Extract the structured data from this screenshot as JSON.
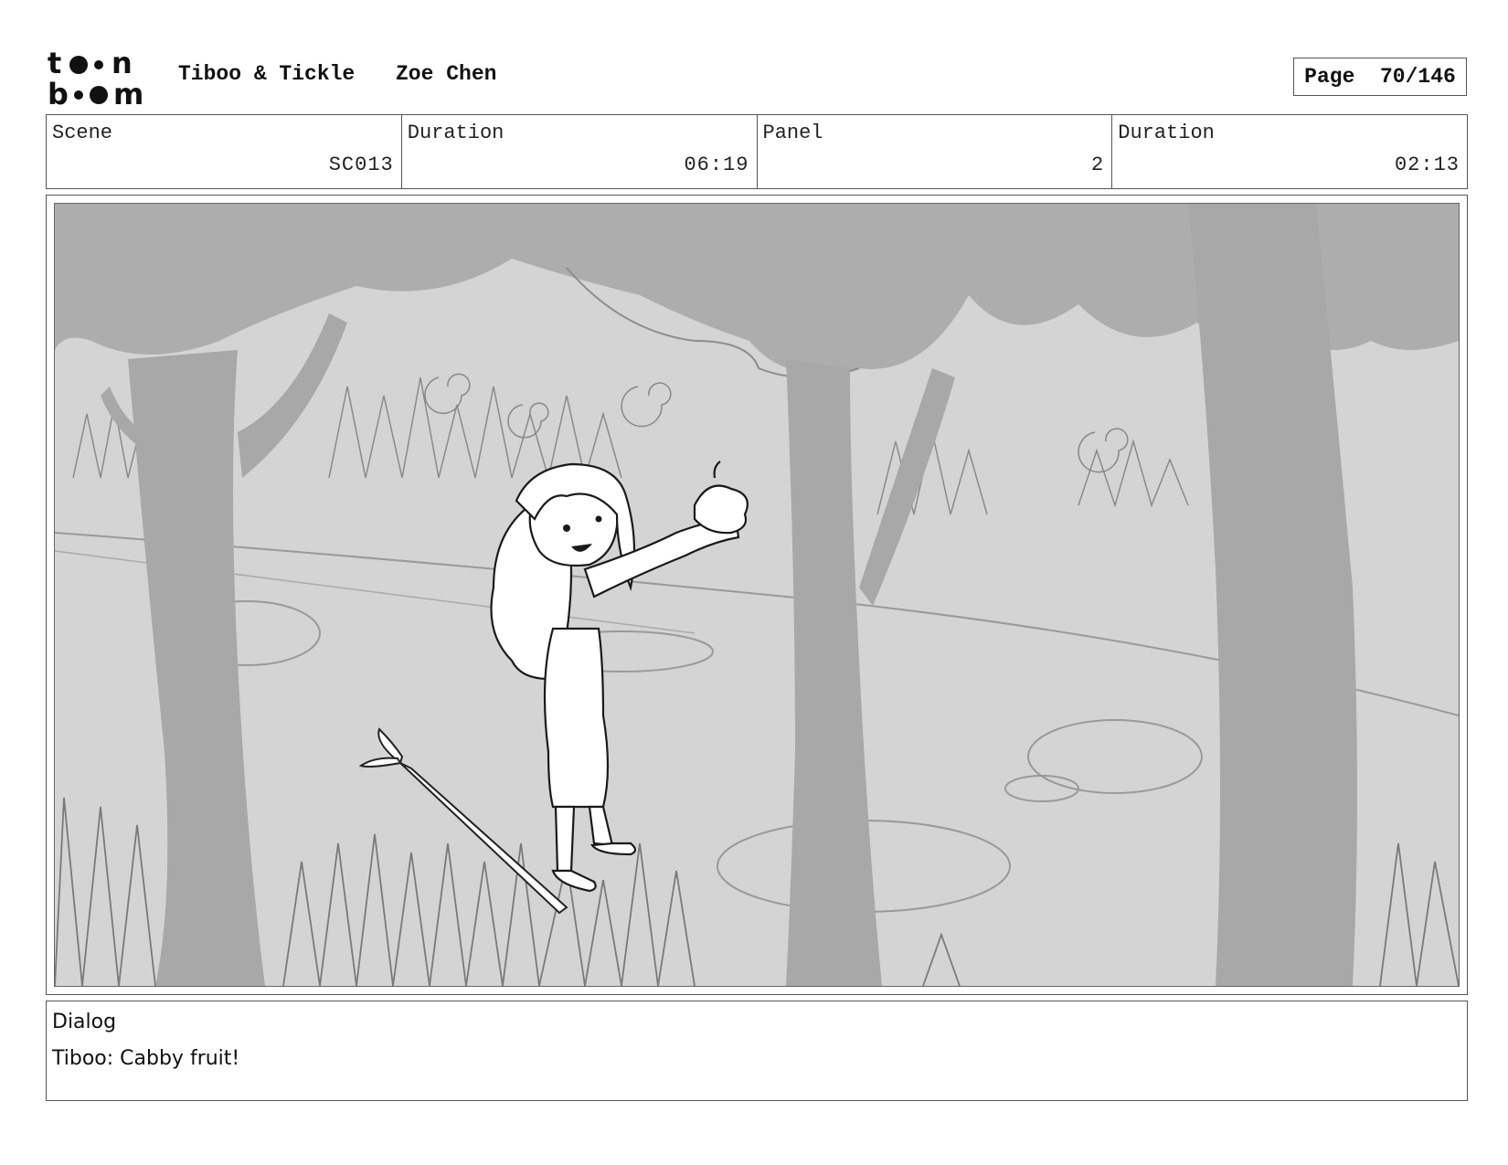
{
  "header": {
    "logo_line1": "t  n",
    "logo_line2": "b  m",
    "project": "Tiboo & Tickle",
    "author": "Zoe Chen",
    "page_label": "Page",
    "page_number": "70/146"
  },
  "info": {
    "scene_label": "Scene",
    "scene_value": "SC013",
    "scene_duration_label": "Duration",
    "scene_duration_value": "06:19",
    "panel_label": "Panel",
    "panel_value": "2",
    "panel_duration_label": "Duration",
    "panel_duration_value": "02:13"
  },
  "dialog": {
    "title": "Dialog",
    "line": "Tiboo: Cabby fruit!"
  }
}
